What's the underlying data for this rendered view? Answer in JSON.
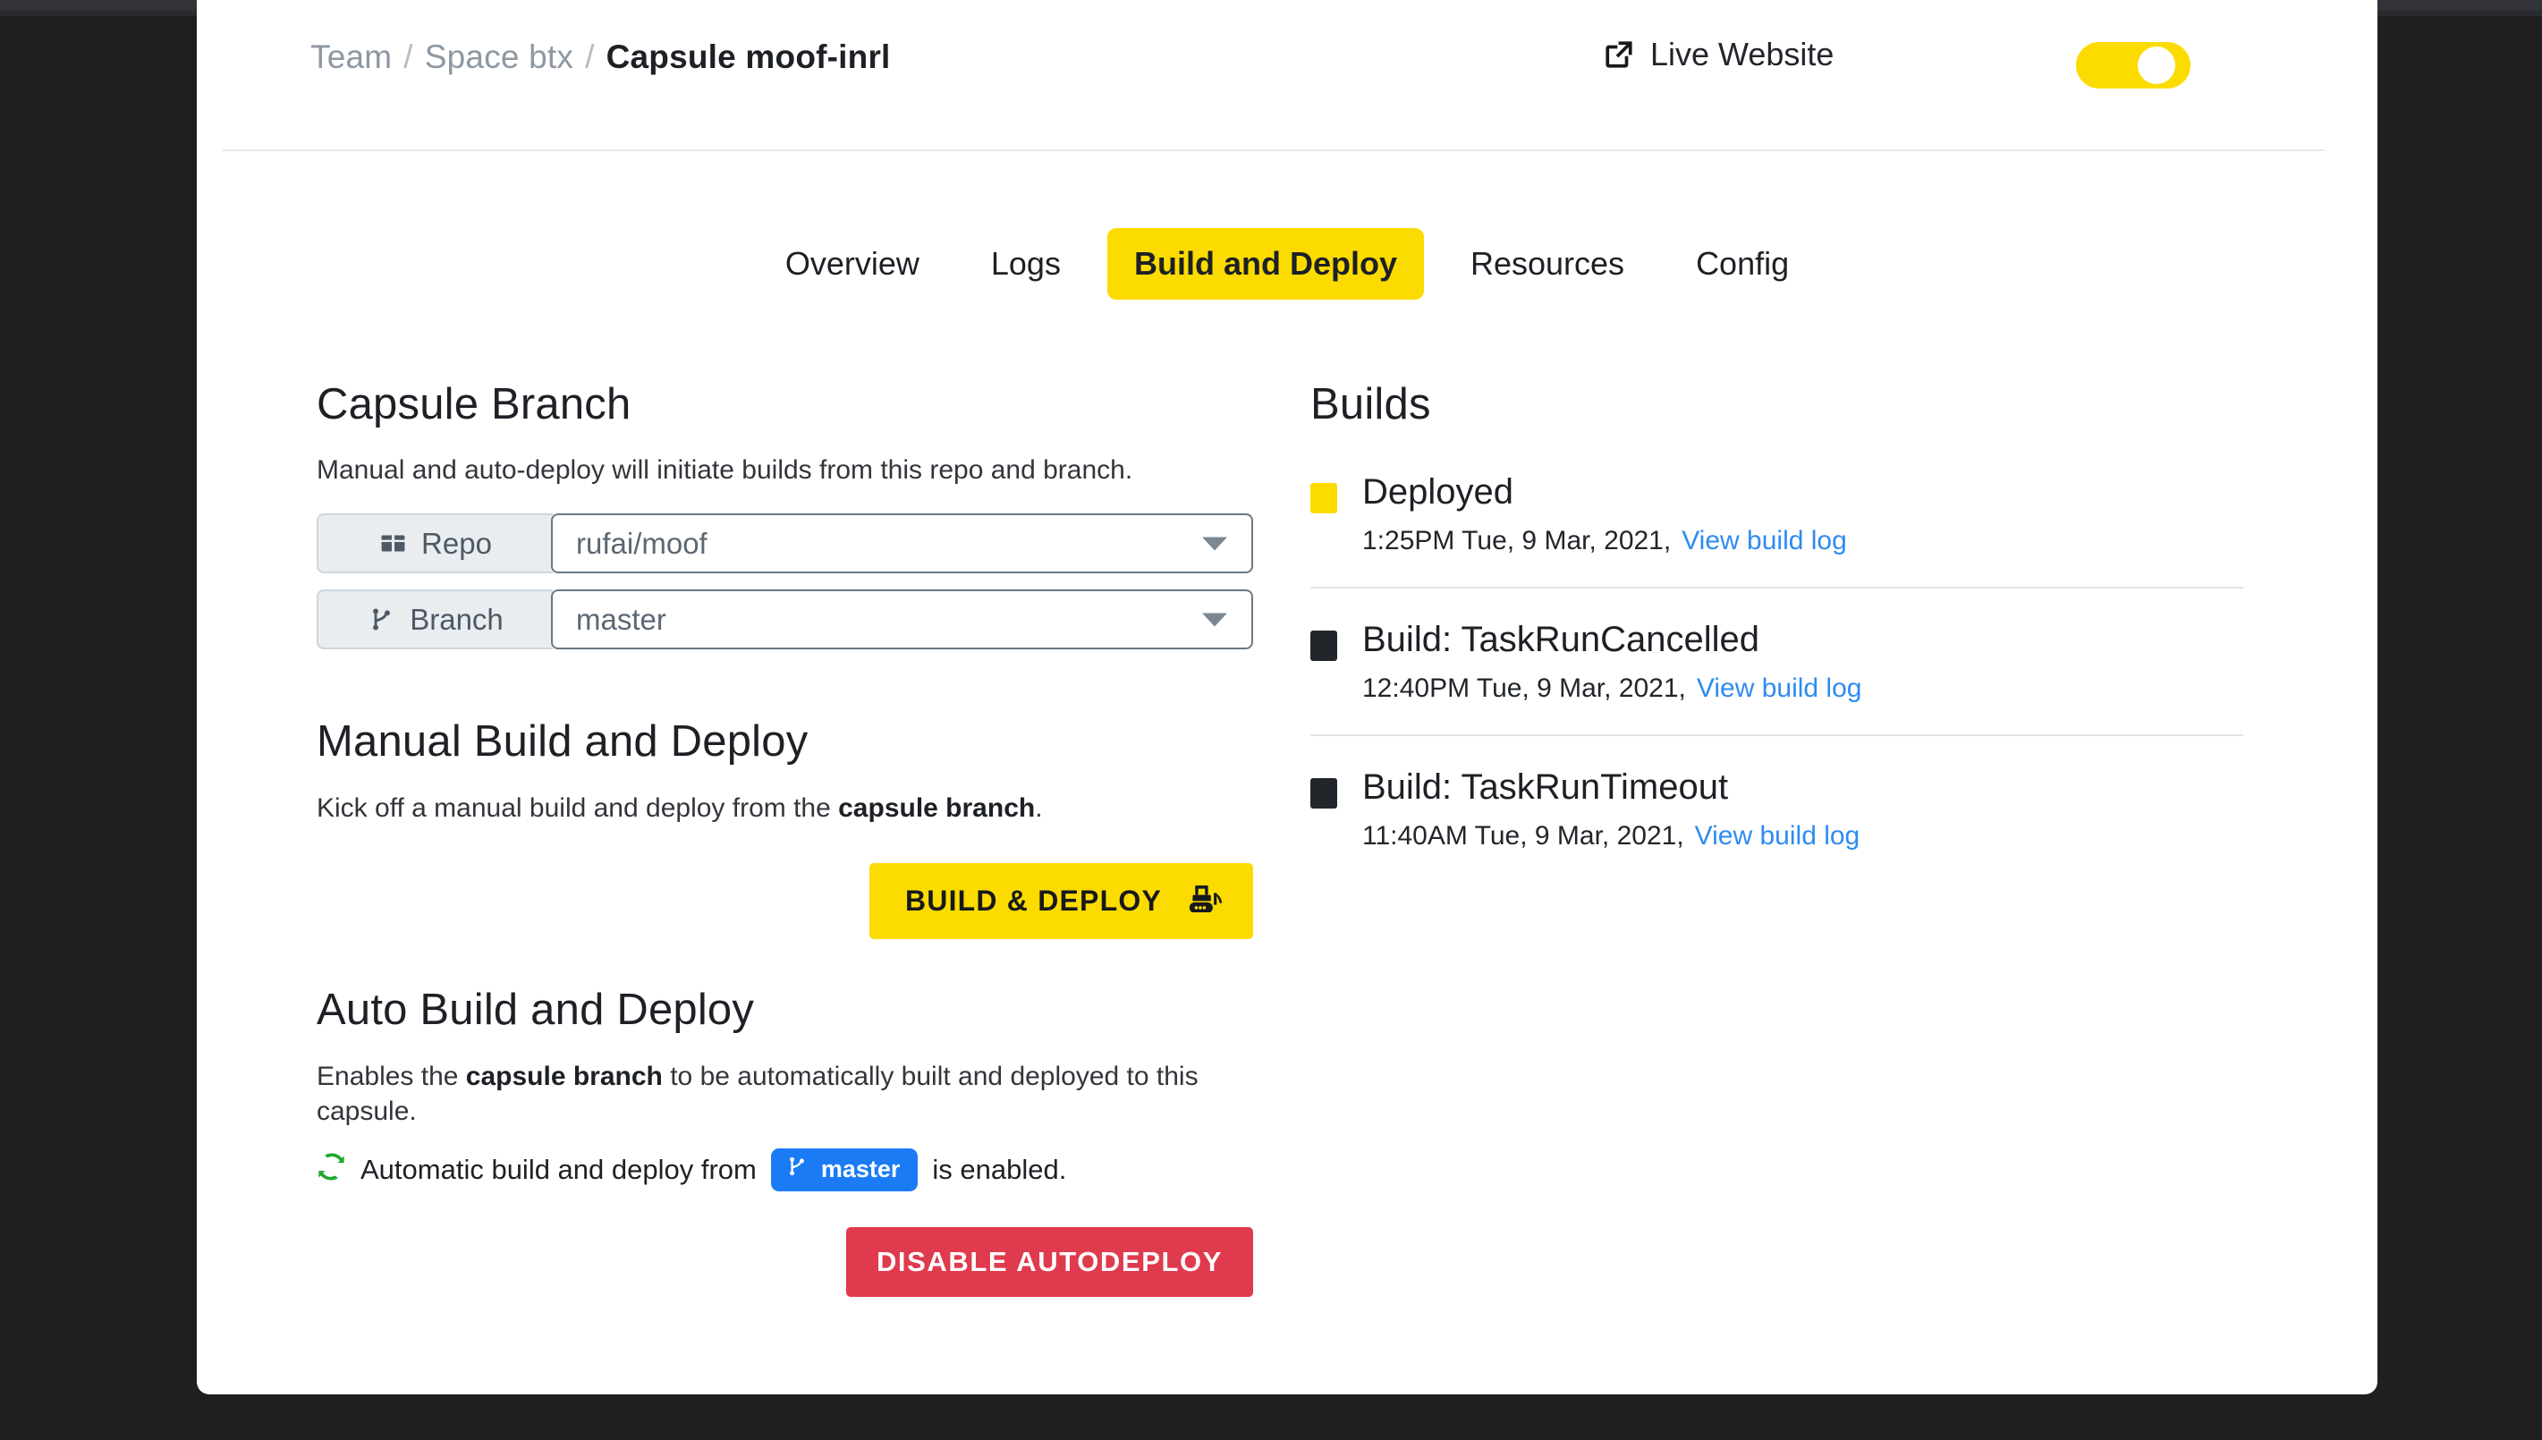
{
  "header": {
    "breadcrumb": {
      "team": "Team",
      "space": "Space btx",
      "capsule": "Capsule moof-inrl",
      "separator": "/"
    },
    "live_website_label": "Live Website",
    "live_website_icon": "external-link-icon",
    "live_toggle_state": "on",
    "accent_color": "#fcdc00"
  },
  "tabs": [
    {
      "label": "Overview",
      "active": false
    },
    {
      "label": "Logs",
      "active": false
    },
    {
      "label": "Build and Deploy",
      "active": true
    },
    {
      "label": "Resources",
      "active": false
    },
    {
      "label": "Config",
      "active": false
    }
  ],
  "capsule_branch": {
    "title": "Capsule Branch",
    "description": "Manual and auto-deploy will initiate builds from this repo and branch.",
    "fields": [
      {
        "label": "Repo",
        "icon": "repo-box-icon",
        "value": "rufai/moof"
      },
      {
        "label": "Branch",
        "icon": "git-branch-icon",
        "value": "master"
      }
    ]
  },
  "manual_build": {
    "title": "Manual Build and Deploy",
    "description_prefix": "Kick off a manual build and deploy from the ",
    "description_bold": "capsule branch",
    "description_suffix": ".",
    "button_label": "BUILD & DEPLOY",
    "button_icon": "bulldozer-icon",
    "button_color": "#fcdc00"
  },
  "auto_build": {
    "title": "Auto Build and Deploy",
    "description_prefix": "Enables the ",
    "description_bold": "capsule branch",
    "description_suffix": " to be automatically built and deployed to this capsule.",
    "status_icon": "sync-refresh-icon",
    "status_icon_color": "#1fa82c",
    "status_prefix": "Automatic build and deploy from",
    "status_branch": "master",
    "status_branch_icon": "git-branch-icon",
    "status_branch_color": "#1a7bf5",
    "status_suffix": "is enabled.",
    "button_label": "DISABLE AUTODEPLOY",
    "button_color": "#e03a4e"
  },
  "builds": {
    "title": "Builds",
    "items": [
      {
        "status": "Deployed",
        "marker_color": "#fcdc00",
        "timestamp": "1:25PM Tue, 9 Mar, 2021,",
        "log_link": "View build log"
      },
      {
        "status": "Build: TaskRunCancelled",
        "marker_color": "#22262b",
        "timestamp": "12:40PM Tue, 9 Mar, 2021,",
        "log_link": "View build log"
      },
      {
        "status": "Build: TaskRunTimeout",
        "marker_color": "#22262b",
        "timestamp": "11:40AM Tue, 9 Mar, 2021,",
        "log_link": "View build log"
      }
    ]
  }
}
